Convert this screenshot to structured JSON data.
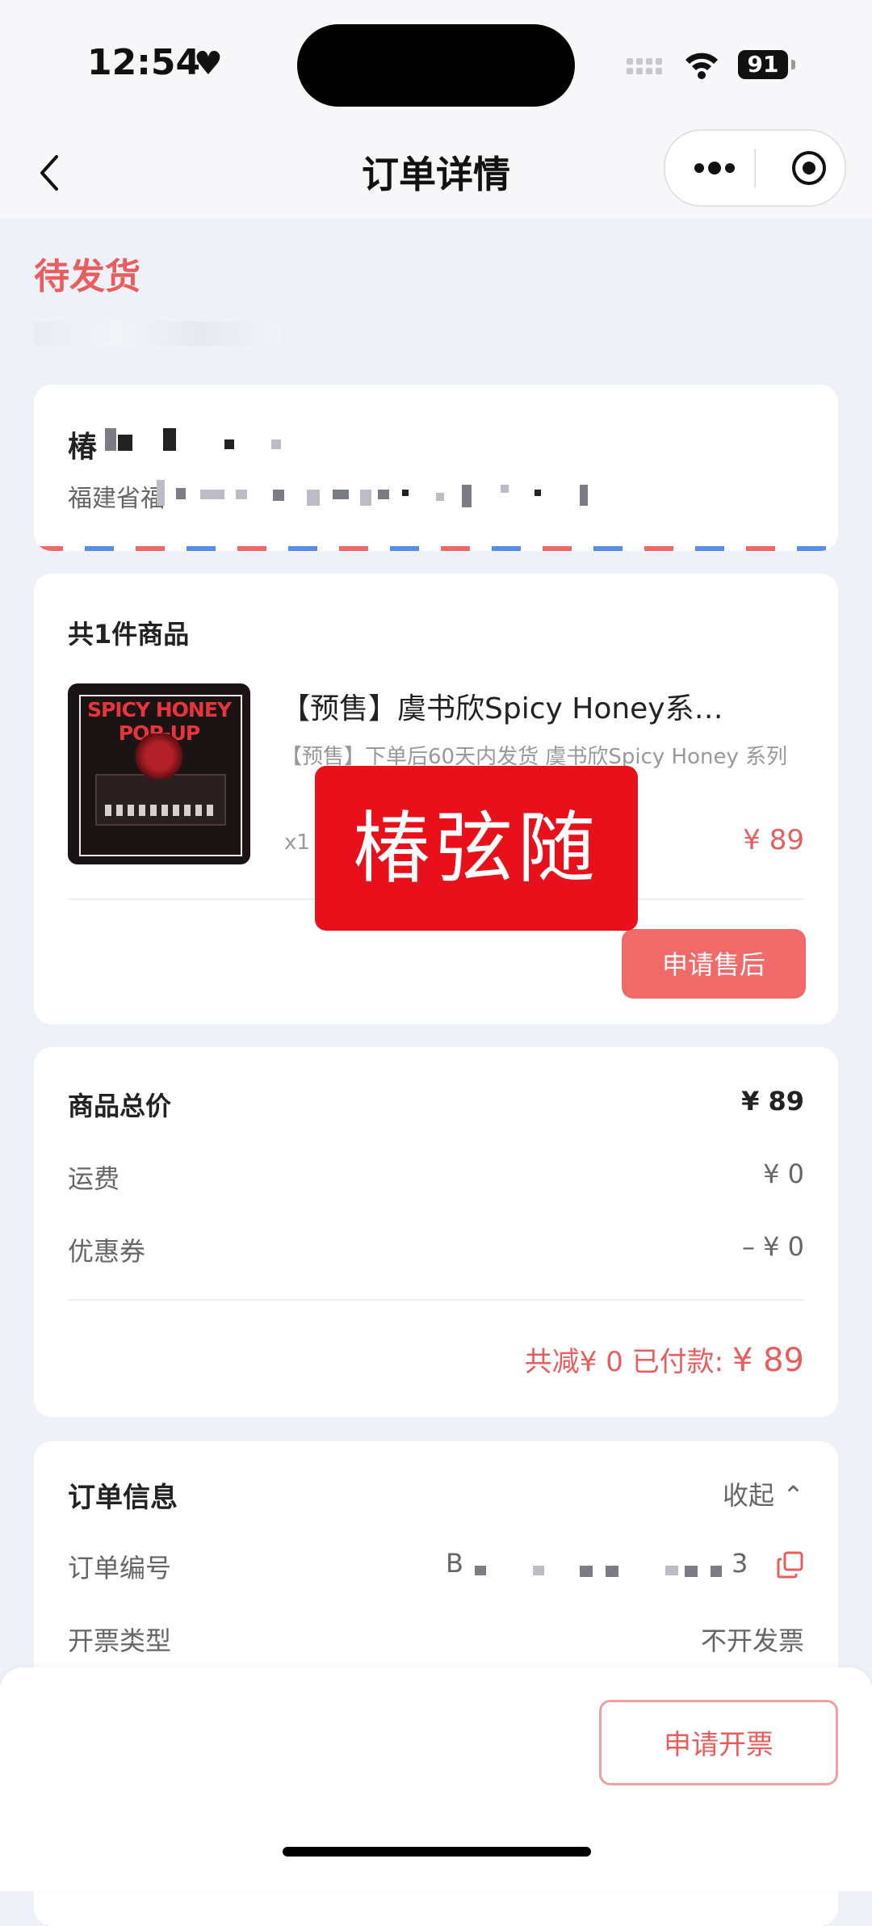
{
  "status_bar": {
    "time": "12:54",
    "battery": "91"
  },
  "nav": {
    "title": "订单详情"
  },
  "order_status": "待发货",
  "address": {
    "name": "椿",
    "line": "福建省福"
  },
  "product_section": {
    "count_label": "共1件商品",
    "image_title": "SPICY HONEY POP-UP",
    "name": "【预售】虞书欣Spicy Honey系…",
    "description": "【预售】下单后60天内发货 虞书欣Spicy Honey 系列",
    "quantity": "x1",
    "price": "¥ 89",
    "after_sale_label": "申请售后"
  },
  "watermark": "椿弦随",
  "price_summary": {
    "total_label": "商品总价",
    "total_value": "¥ 89",
    "shipping_label": "运费",
    "shipping_value": "¥ 0",
    "coupon_label": "优惠券",
    "coupon_value": "– ¥ 0",
    "reduced": "共减¥ 0",
    "paid_label": "已付款:",
    "paid_value": "¥ 89"
  },
  "order_info": {
    "title": "订单信息",
    "collapse_label": "收起 ⌃",
    "number_label": "订单编号",
    "number_prefix": "B",
    "number_suffix": "3",
    "invoice_type_label": "开票类型",
    "invoice_type_value": "不开发票"
  },
  "bottom": {
    "invoice_button": "申请开票"
  },
  "colors": {
    "accent": "#e85e5e",
    "background": "#eef1f8",
    "button": "#f06a6a"
  }
}
